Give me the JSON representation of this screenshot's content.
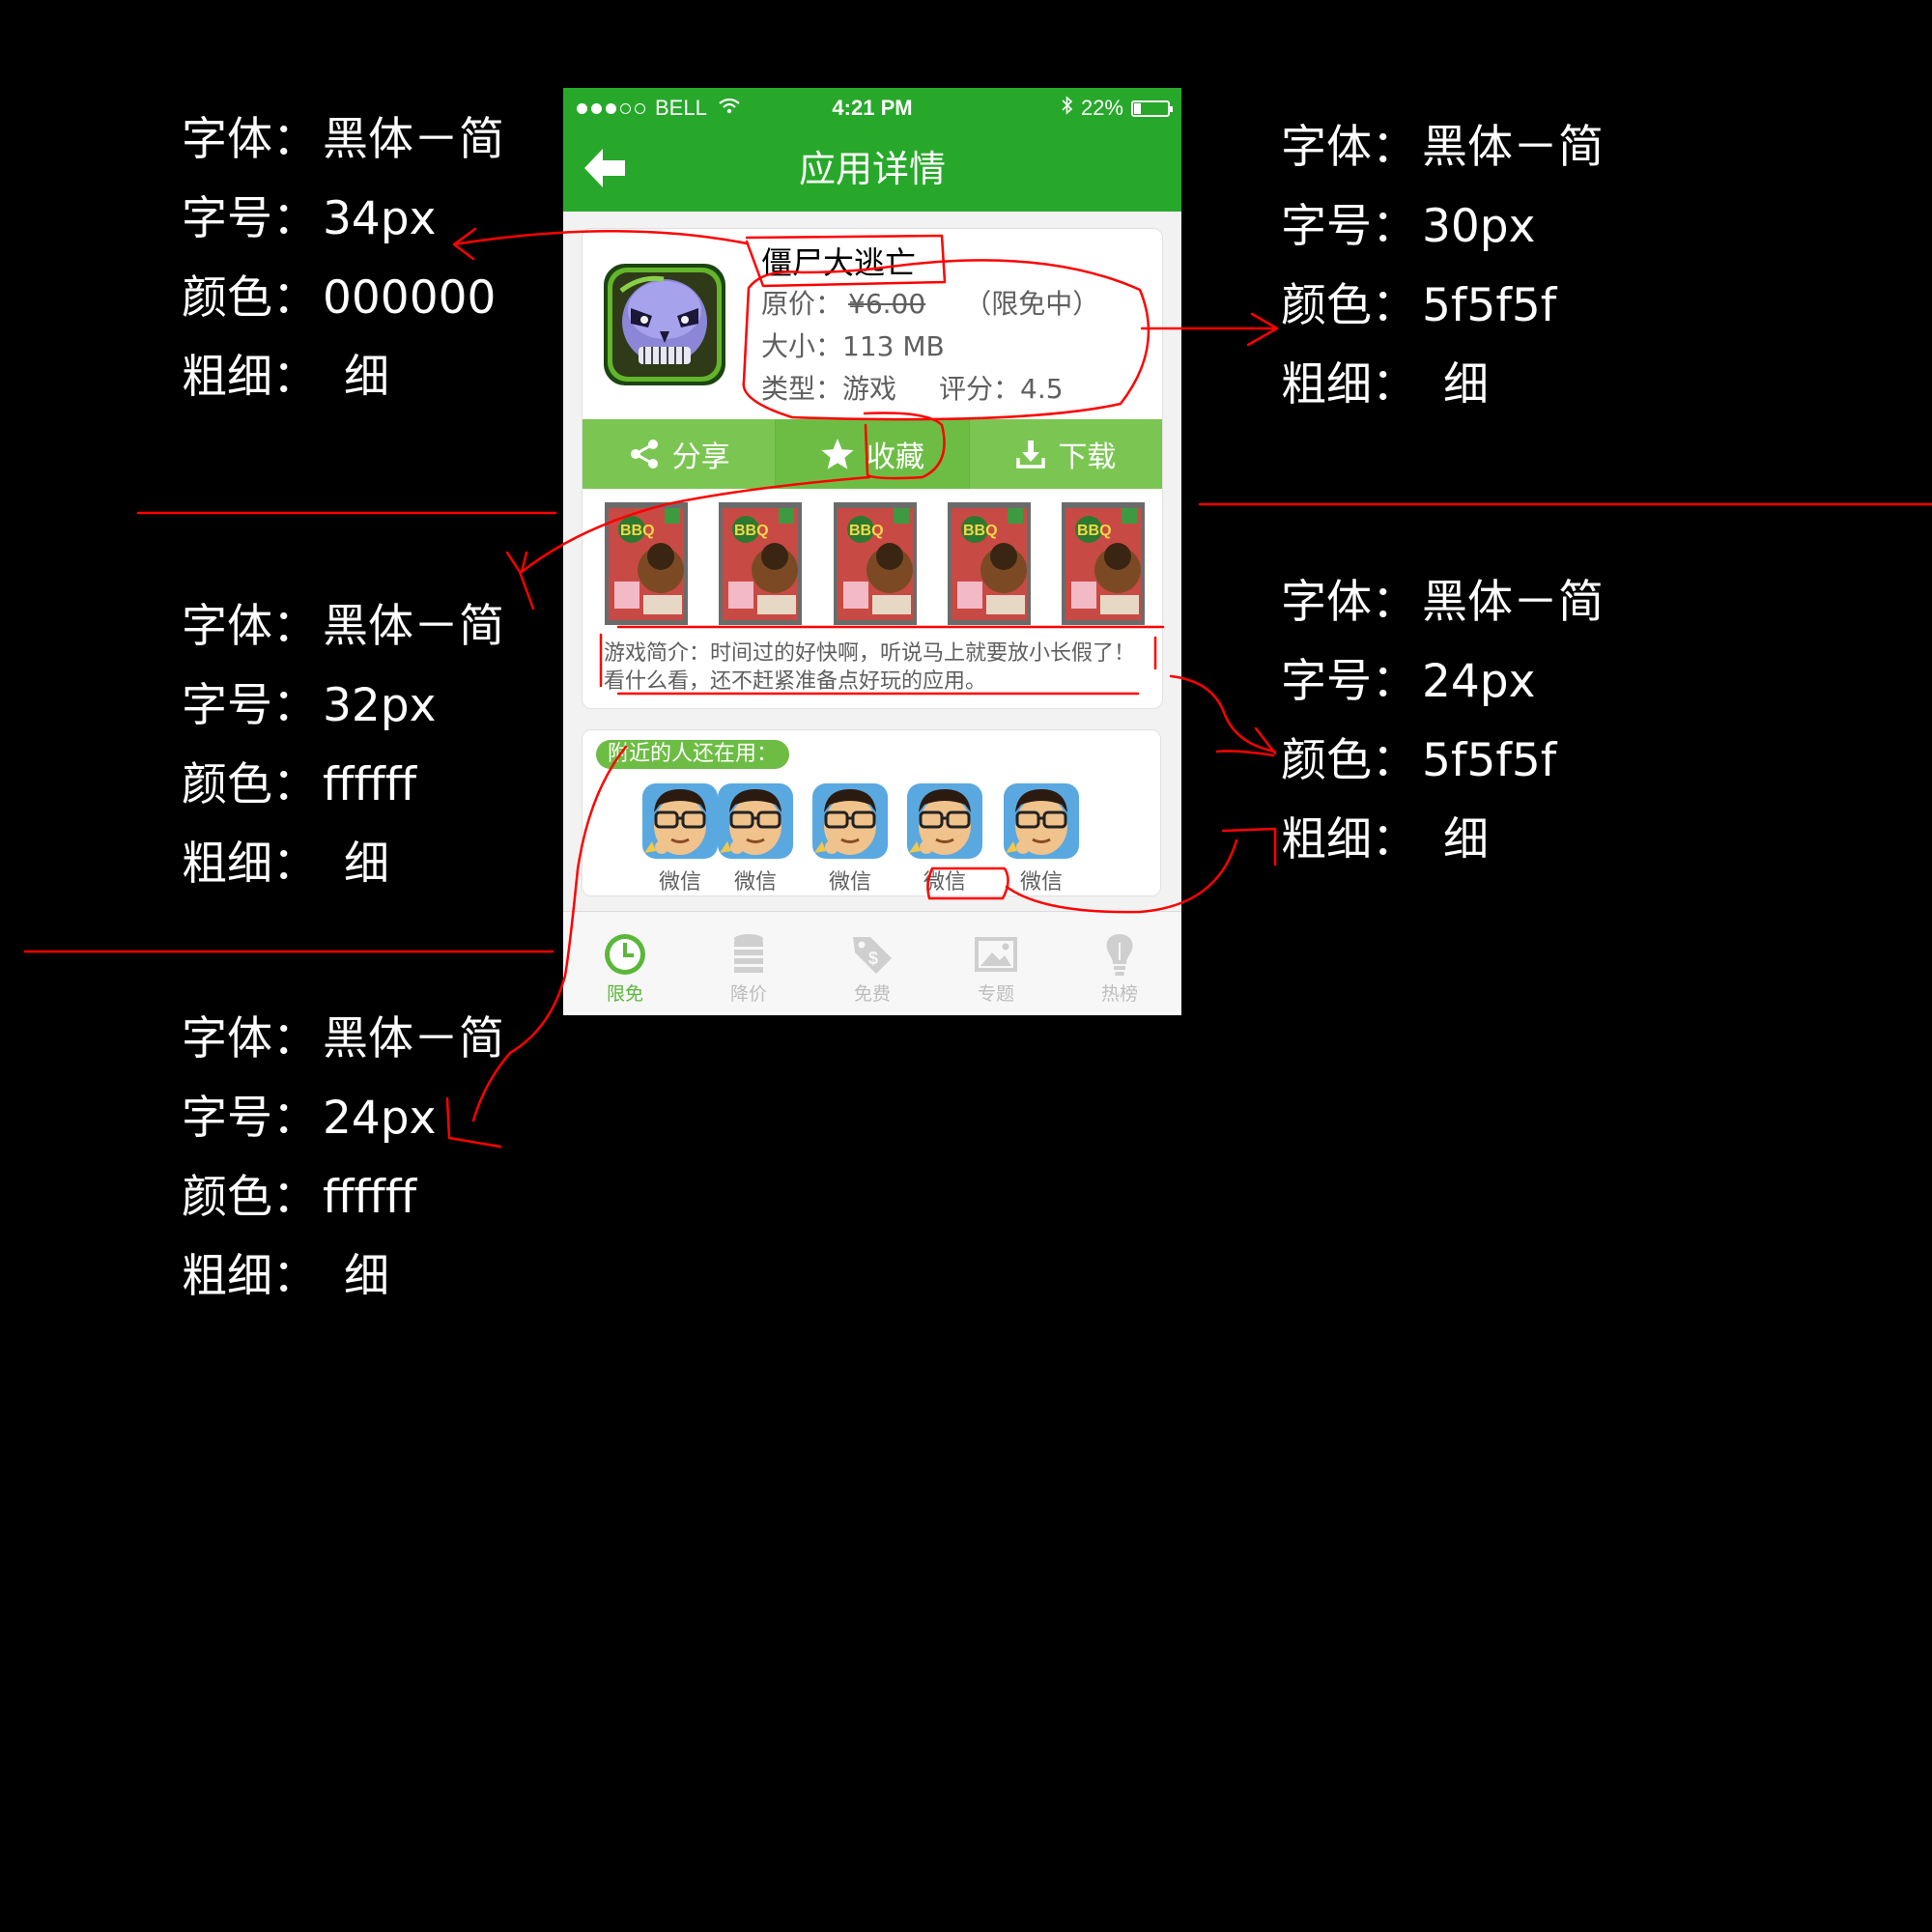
{
  "annotations": [
    {
      "font_label": "字体",
      "font": "黑体－简",
      "size_label": "字号",
      "size": "34px",
      "color_label": "颜色",
      "color": "000000",
      "weight_label": "粗细",
      "weight": "细"
    },
    {
      "font_label": "字体",
      "font": "黑体－简",
      "size_label": "字号",
      "size": "30px",
      "color_label": "颜色",
      "color": "5f5f5f",
      "weight_label": "粗细",
      "weight": "细"
    },
    {
      "font_label": "字体",
      "font": "黑体－简",
      "size_label": "字号",
      "size": "32px",
      "color_label": "颜色",
      "color": "ffffff",
      "weight_label": "粗细",
      "weight": "细"
    },
    {
      "font_label": "字体",
      "font": "黑体－简",
      "size_label": "字号",
      "size": "24px",
      "color_label": "颜色",
      "color": "5f5f5f",
      "weight_label": "粗细",
      "weight": "细"
    },
    {
      "font_label": "字体",
      "font": "黑体－简",
      "size_label": "字号",
      "size": "24px",
      "color_label": "颜色",
      "color": "ffffff",
      "weight_label": "粗细",
      "weight": "细"
    }
  ],
  "status_bar": {
    "carrier": "BELL",
    "time": "4:21 PM",
    "battery": "22%",
    "battery_level": 0.22
  },
  "nav": {
    "title": "应用详情",
    "back_icon": "back-arrow-icon"
  },
  "app": {
    "name": "僵尸大逃亡",
    "price_label": "原价：",
    "price": "¥6.00",
    "free_tag": "（限免中）",
    "size_label": "大小：",
    "size": "113 MB",
    "type_label": "类型：",
    "type": "游戏",
    "rating_label": "评分：",
    "rating": "4.5"
  },
  "actions": {
    "share": "分享",
    "favorite": "收藏",
    "download": "下载"
  },
  "intro": "游戏简介：时间过的好快啊，听说马上就要放小长假了！看什么看，还不赶紧准备点好玩的应用。",
  "nearby": {
    "title": "附近的人还在用：",
    "users": [
      {
        "name": "微信"
      },
      {
        "name": "微信"
      },
      {
        "name": "微信"
      },
      {
        "name": "微信"
      },
      {
        "name": "微信"
      }
    ]
  },
  "tabs": [
    {
      "label": "限免",
      "icon": "clock-icon",
      "active": true
    },
    {
      "label": "降价",
      "icon": "coin-stack-icon",
      "active": false
    },
    {
      "label": "免费",
      "icon": "price-tag-icon",
      "active": false
    },
    {
      "label": "专题",
      "icon": "picture-icon",
      "active": false
    },
    {
      "label": "热榜",
      "icon": "lightbulb-icon",
      "active": false
    }
  ],
  "colors": {
    "green": "#27a82a",
    "light_green": "#7bc652",
    "text_gray": "#5f5f5f",
    "annotation_red": "#ff0000"
  }
}
